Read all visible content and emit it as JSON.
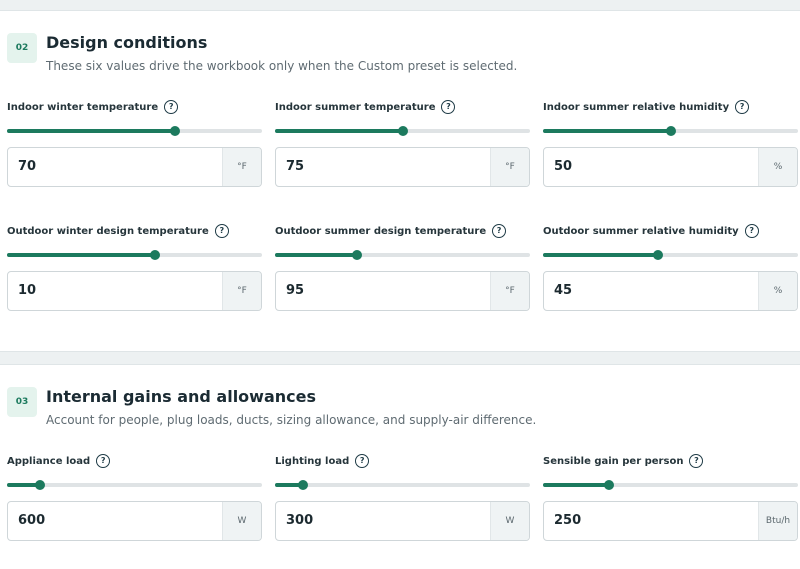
{
  "sections": [
    {
      "badge": "02",
      "title": "Design conditions",
      "subtitle": "These six values drive the workbook only when the Custom preset is selected.",
      "fields": [
        {
          "label": "Indoor winter temperature",
          "help": "?",
          "value": "70",
          "unit": "°F",
          "level": 0.66
        },
        {
          "label": "Indoor summer temperature",
          "help": "?",
          "value": "75",
          "unit": "°F",
          "level": 0.5
        },
        {
          "label": "Indoor summer relative humidity",
          "help": "?",
          "value": "50",
          "unit": "%",
          "level": 0.5
        },
        {
          "label": "Outdoor winter design temperature",
          "help": "?",
          "value": "10",
          "unit": "°F",
          "level": 0.58
        },
        {
          "label": "Outdoor summer design temperature",
          "help": "?",
          "value": "95",
          "unit": "°F",
          "level": 0.32
        },
        {
          "label": "Outdoor summer relative humidity",
          "help": "?",
          "value": "45",
          "unit": "%",
          "level": 0.45
        }
      ]
    },
    {
      "badge": "03",
      "title": "Internal gains and allowances",
      "subtitle": "Account for people, plug loads, ducts, sizing allowance, and supply-air difference.",
      "fields": [
        {
          "label": "Appliance load",
          "help": "?",
          "value": "600",
          "unit": "W",
          "level": 0.13
        },
        {
          "label": "Lighting load",
          "help": "?",
          "value": "300",
          "unit": "W",
          "level": 0.11
        },
        {
          "label": "Sensible gain per person",
          "help": "?",
          "value": "250",
          "unit": "Btu/h",
          "level": 0.26
        }
      ]
    }
  ],
  "colors": {
    "accent": "#1c7a5e",
    "track": "#dfe3e5",
    "badge_bg": "#e4f3ed"
  }
}
